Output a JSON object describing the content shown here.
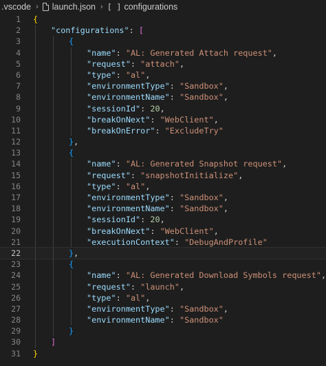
{
  "breadcrumb": {
    "folder": ".vscode",
    "file": "launch.json",
    "symbol_icon": "[ ]",
    "symbol": "configurations",
    "separator": "›"
  },
  "editor": {
    "current_line": 22,
    "lines": [
      {
        "n": "1",
        "indent": 0,
        "tokens": [
          {
            "t": "{",
            "c": "b1"
          }
        ]
      },
      {
        "n": "2",
        "indent": 1,
        "tokens": [
          {
            "t": "\"configurations\"",
            "c": "key"
          },
          {
            "t": ": ",
            "c": "punc"
          },
          {
            "t": "[",
            "c": "b2"
          }
        ]
      },
      {
        "n": "3",
        "indent": 2,
        "tokens": [
          {
            "t": "{",
            "c": "b3"
          }
        ]
      },
      {
        "n": "4",
        "indent": 3,
        "tokens": [
          {
            "t": "\"name\"",
            "c": "key"
          },
          {
            "t": ": ",
            "c": "punc"
          },
          {
            "t": "\"AL: Generated Attach request\"",
            "c": "str"
          },
          {
            "t": ",",
            "c": "punc"
          }
        ]
      },
      {
        "n": "5",
        "indent": 3,
        "tokens": [
          {
            "t": "\"request\"",
            "c": "key"
          },
          {
            "t": ": ",
            "c": "punc"
          },
          {
            "t": "\"attach\"",
            "c": "str"
          },
          {
            "t": ",",
            "c": "punc"
          }
        ]
      },
      {
        "n": "6",
        "indent": 3,
        "tokens": [
          {
            "t": "\"type\"",
            "c": "key"
          },
          {
            "t": ": ",
            "c": "punc"
          },
          {
            "t": "\"al\"",
            "c": "str"
          },
          {
            "t": ",",
            "c": "punc"
          }
        ]
      },
      {
        "n": "7",
        "indent": 3,
        "tokens": [
          {
            "t": "\"environmentType\"",
            "c": "key"
          },
          {
            "t": ": ",
            "c": "punc"
          },
          {
            "t": "\"Sandbox\"",
            "c": "str"
          },
          {
            "t": ",",
            "c": "punc"
          }
        ]
      },
      {
        "n": "8",
        "indent": 3,
        "tokens": [
          {
            "t": "\"environmentName\"",
            "c": "key"
          },
          {
            "t": ": ",
            "c": "punc"
          },
          {
            "t": "\"Sandbox\"",
            "c": "str"
          },
          {
            "t": ",",
            "c": "punc"
          }
        ]
      },
      {
        "n": "9",
        "indent": 3,
        "tokens": [
          {
            "t": "\"sessionId\"",
            "c": "key"
          },
          {
            "t": ": ",
            "c": "punc"
          },
          {
            "t": "20",
            "c": "num"
          },
          {
            "t": ",",
            "c": "punc"
          }
        ]
      },
      {
        "n": "10",
        "indent": 3,
        "tokens": [
          {
            "t": "\"breakOnNext\"",
            "c": "key"
          },
          {
            "t": ": ",
            "c": "punc"
          },
          {
            "t": "\"WebClient\"",
            "c": "str"
          },
          {
            "t": ",",
            "c": "punc"
          }
        ]
      },
      {
        "n": "11",
        "indent": 3,
        "tokens": [
          {
            "t": "\"breakOnError\"",
            "c": "key"
          },
          {
            "t": ": ",
            "c": "punc"
          },
          {
            "t": "\"ExcludeTry\"",
            "c": "str"
          }
        ]
      },
      {
        "n": "12",
        "indent": 2,
        "tokens": [
          {
            "t": "}",
            "c": "b3"
          },
          {
            "t": ",",
            "c": "punc"
          }
        ]
      },
      {
        "n": "13",
        "indent": 2,
        "tokens": [
          {
            "t": "{",
            "c": "b3"
          }
        ]
      },
      {
        "n": "14",
        "indent": 3,
        "tokens": [
          {
            "t": "\"name\"",
            "c": "key"
          },
          {
            "t": ": ",
            "c": "punc"
          },
          {
            "t": "\"AL: Generated Snapshot request\"",
            "c": "str"
          },
          {
            "t": ",",
            "c": "punc"
          }
        ]
      },
      {
        "n": "15",
        "indent": 3,
        "tokens": [
          {
            "t": "\"request\"",
            "c": "key"
          },
          {
            "t": ": ",
            "c": "punc"
          },
          {
            "t": "\"snapshotInitialize\"",
            "c": "str"
          },
          {
            "t": ",",
            "c": "punc"
          }
        ]
      },
      {
        "n": "16",
        "indent": 3,
        "tokens": [
          {
            "t": "\"type\"",
            "c": "key"
          },
          {
            "t": ": ",
            "c": "punc"
          },
          {
            "t": "\"al\"",
            "c": "str"
          },
          {
            "t": ",",
            "c": "punc"
          }
        ]
      },
      {
        "n": "17",
        "indent": 3,
        "tokens": [
          {
            "t": "\"environmentType\"",
            "c": "key"
          },
          {
            "t": ": ",
            "c": "punc"
          },
          {
            "t": "\"Sandbox\"",
            "c": "str"
          },
          {
            "t": ",",
            "c": "punc"
          }
        ]
      },
      {
        "n": "18",
        "indent": 3,
        "tokens": [
          {
            "t": "\"environmentName\"",
            "c": "key"
          },
          {
            "t": ": ",
            "c": "punc"
          },
          {
            "t": "\"Sandbox\"",
            "c": "str"
          },
          {
            "t": ",",
            "c": "punc"
          }
        ]
      },
      {
        "n": "19",
        "indent": 3,
        "tokens": [
          {
            "t": "\"sessionId\"",
            "c": "key"
          },
          {
            "t": ": ",
            "c": "punc"
          },
          {
            "t": "20",
            "c": "num"
          },
          {
            "t": ",",
            "c": "punc"
          }
        ]
      },
      {
        "n": "20",
        "indent": 3,
        "tokens": [
          {
            "t": "\"breakOnNext\"",
            "c": "key"
          },
          {
            "t": ": ",
            "c": "punc"
          },
          {
            "t": "\"WebClient\"",
            "c": "str"
          },
          {
            "t": ",",
            "c": "punc"
          }
        ]
      },
      {
        "n": "21",
        "indent": 3,
        "tokens": [
          {
            "t": "\"executionContext\"",
            "c": "key"
          },
          {
            "t": ": ",
            "c": "punc"
          },
          {
            "t": "\"DebugAndProfile\"",
            "c": "str"
          }
        ]
      },
      {
        "n": "22",
        "indent": 2,
        "tokens": [
          {
            "t": "}",
            "c": "b3"
          },
          {
            "t": ",",
            "c": "punc"
          }
        ]
      },
      {
        "n": "23",
        "indent": 2,
        "tokens": [
          {
            "t": "{",
            "c": "b3"
          }
        ]
      },
      {
        "n": "24",
        "indent": 3,
        "tokens": [
          {
            "t": "\"name\"",
            "c": "key"
          },
          {
            "t": ": ",
            "c": "punc"
          },
          {
            "t": "\"AL: Generated Download Symbols request\"",
            "c": "str"
          },
          {
            "t": ",",
            "c": "punc"
          }
        ]
      },
      {
        "n": "25",
        "indent": 3,
        "tokens": [
          {
            "t": "\"request\"",
            "c": "key"
          },
          {
            "t": ": ",
            "c": "punc"
          },
          {
            "t": "\"launch\"",
            "c": "str"
          },
          {
            "t": ",",
            "c": "punc"
          }
        ]
      },
      {
        "n": "26",
        "indent": 3,
        "tokens": [
          {
            "t": "\"type\"",
            "c": "key"
          },
          {
            "t": ": ",
            "c": "punc"
          },
          {
            "t": "\"al\"",
            "c": "str"
          },
          {
            "t": ",",
            "c": "punc"
          }
        ]
      },
      {
        "n": "27",
        "indent": 3,
        "tokens": [
          {
            "t": "\"environmentType\"",
            "c": "key"
          },
          {
            "t": ": ",
            "c": "punc"
          },
          {
            "t": "\"Sandbox\"",
            "c": "str"
          },
          {
            "t": ",",
            "c": "punc"
          }
        ]
      },
      {
        "n": "28",
        "indent": 3,
        "tokens": [
          {
            "t": "\"environmentName\"",
            "c": "key"
          },
          {
            "t": ": ",
            "c": "punc"
          },
          {
            "t": "\"Sandbox\"",
            "c": "str"
          }
        ]
      },
      {
        "n": "29",
        "indent": 2,
        "tokens": [
          {
            "t": "}",
            "c": "b3"
          }
        ]
      },
      {
        "n": "30",
        "indent": 1,
        "tokens": [
          {
            "t": "]",
            "c": "b2"
          }
        ]
      },
      {
        "n": "31",
        "indent": 0,
        "tokens": [
          {
            "t": "}",
            "c": "b1"
          }
        ]
      }
    ]
  },
  "colors": {
    "background": "#1e1e1e",
    "key": "#9cdcfe",
    "string": "#ce9178",
    "number": "#b5cea8",
    "bracket_level1": "#ffd700",
    "bracket_level2": "#da70d6",
    "bracket_level3": "#179fff",
    "line_number": "#858585"
  }
}
